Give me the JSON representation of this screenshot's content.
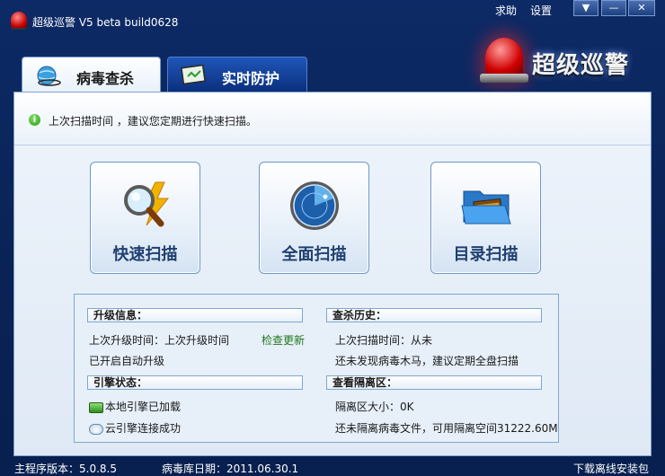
{
  "window": {
    "title": "超级巡警 V5 beta build0628",
    "help": "求助",
    "settings": "设置",
    "minimize_glyph": "▬",
    "min_glyph": "—",
    "close_glyph": "✕"
  },
  "brand": {
    "text": "超级巡警"
  },
  "tabs": [
    {
      "label": "病毒查杀",
      "icon": "globe-scan-icon",
      "active": true
    },
    {
      "label": "实时防护",
      "icon": "monitor-shield-icon",
      "active": false
    }
  ],
  "notice": {
    "icon": "info-icon",
    "text": "上次扫描时间 ，建议您定期进行快速扫描。"
  },
  "scan_buttons": [
    {
      "label": "快速扫描",
      "icon": "magnifier-lightning-icon"
    },
    {
      "label": "全面扫描",
      "icon": "radar-icon"
    },
    {
      "label": "目录扫描",
      "icon": "folder-card-icon"
    }
  ],
  "upgrade": {
    "header": "升级信息：",
    "last_upgrade": "上次升级时间：上次升级时间",
    "check_update": "检查更新",
    "auto_upgrade": "已开启自动升级"
  },
  "engine": {
    "header": "引擎状态：",
    "local": "本地引擎已加载",
    "cloud": "云引擎连接成功"
  },
  "history": {
    "header": "查杀历史：",
    "last_scan": "上次扫描时间：从未",
    "result": "还未发现病毒木马，建议定期全盘扫描"
  },
  "quarantine": {
    "header": "查看隔离区：",
    "size": "隔离区大小：0K",
    "status": "还未隔离病毒文件，可用隔离空间31222.60M"
  },
  "status_bar": {
    "version": "主程序版本：5.0.8.5",
    "db_date": "病毒库日期：2011.06.30.1",
    "download": "下载离线安装包"
  },
  "colors": {
    "accent": "#0d2a66",
    "link": "#1e7a1e",
    "alert": "#d00000"
  }
}
